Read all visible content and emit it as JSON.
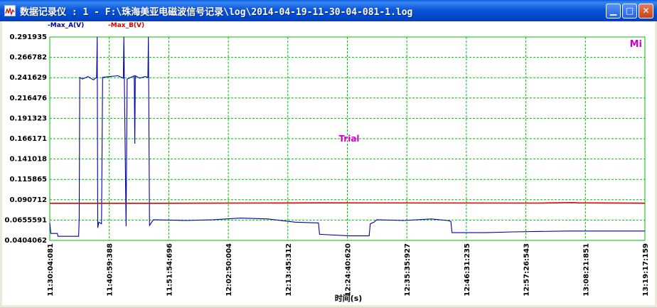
{
  "window": {
    "title": "数据记录仪 : 1 - F:\\珠海美亚电磁波信号记录\\log\\2014-04-19-11-30-04-081-1.log",
    "icon": "chart-app-icon",
    "buttons": {
      "minimize": "minimize-icon",
      "maximize": "maximize-icon",
      "close": "close-icon"
    }
  },
  "legend": {
    "series_a_label": "-Max_A(V)",
    "series_b_label": "-Max_B(V)"
  },
  "watermark": "Trial",
  "corner_label": "Mi",
  "colors": {
    "series_a": "#0000a8",
    "series_b": "#e00000",
    "grid": "#00c000",
    "watermark": "#cc00cc"
  },
  "chart_data": {
    "type": "line",
    "xlabel": "时间(s)",
    "ylabel": "",
    "y_ticks": [
      "0.291935",
      "0.266782",
      "0.241629",
      "0.216476",
      "0.191323",
      "0.166171",
      "0.141018",
      "0.115865",
      "0.090712",
      "0.0655591",
      "0.0404062"
    ],
    "ylim": [
      0.0404062,
      0.291935
    ],
    "x_ticks": [
      "11:30:04:081",
      "11:40:59:388",
      "11:51:54:696",
      "12:02:50:004",
      "12:13:45:312",
      "12:24:40:620",
      "12:35:35:927",
      "12:46:31:235",
      "12:57:26:543",
      "13:08:21:851",
      "13:19:17:159"
    ],
    "x_range_minutes": [
      0,
      109.2
    ],
    "grid": true,
    "series": [
      {
        "name": "Max_A(V)",
        "points": [
          [
            0,
            0.062
          ],
          [
            0.2,
            0.049
          ],
          [
            1.4,
            0.049
          ],
          [
            1.5,
            0.0455
          ],
          [
            5.3,
            0.0455
          ],
          [
            5.4,
            0.068
          ],
          [
            5.5,
            0.242
          ],
          [
            6.0,
            0.24
          ],
          [
            7.0,
            0.243
          ],
          [
            8.0,
            0.239
          ],
          [
            8.6,
            0.242
          ],
          [
            8.7,
            0.292
          ],
          [
            8.8,
            0.056
          ],
          [
            9.0,
            0.063
          ],
          [
            9.5,
            0.061
          ],
          [
            9.7,
            0.242
          ],
          [
            11.0,
            0.243
          ],
          [
            12.5,
            0.244
          ],
          [
            13.5,
            0.241
          ],
          [
            13.6,
            0.292
          ],
          [
            14.0,
            0.058
          ],
          [
            14.2,
            0.24
          ],
          [
            15.5,
            0.244
          ],
          [
            15.6,
            0.16
          ],
          [
            15.7,
            0.244
          ],
          [
            16.5,
            0.241
          ],
          [
            17.5,
            0.243
          ],
          [
            18.0,
            0.242
          ],
          [
            18.1,
            0.292
          ],
          [
            18.3,
            0.059
          ],
          [
            19.0,
            0.066
          ],
          [
            25.0,
            0.065
          ],
          [
            30.0,
            0.066
          ],
          [
            35.0,
            0.068
          ],
          [
            40.0,
            0.067
          ],
          [
            45.0,
            0.063
          ],
          [
            49.3,
            0.062
          ],
          [
            49.5,
            0.048
          ],
          [
            55.0,
            0.046
          ],
          [
            58.6,
            0.046
          ],
          [
            58.8,
            0.061
          ],
          [
            59.5,
            0.063
          ],
          [
            60.0,
            0.066
          ],
          [
            65.0,
            0.065
          ],
          [
            70.0,
            0.067
          ],
          [
            73.0,
            0.065
          ],
          [
            73.6,
            0.064
          ],
          [
            73.8,
            0.05
          ],
          [
            80.0,
            0.05
          ],
          [
            85.0,
            0.051
          ],
          [
            95.0,
            0.052
          ],
          [
            109.2,
            0.052
          ]
        ]
      },
      {
        "name": "Max_B(V)",
        "points": [
          [
            0,
            0.0863
          ],
          [
            20,
            0.0863
          ],
          [
            50,
            0.0868
          ],
          [
            90,
            0.0866
          ],
          [
            96,
            0.0872
          ],
          [
            97,
            0.0868
          ],
          [
            109.2,
            0.0864
          ]
        ]
      }
    ]
  }
}
